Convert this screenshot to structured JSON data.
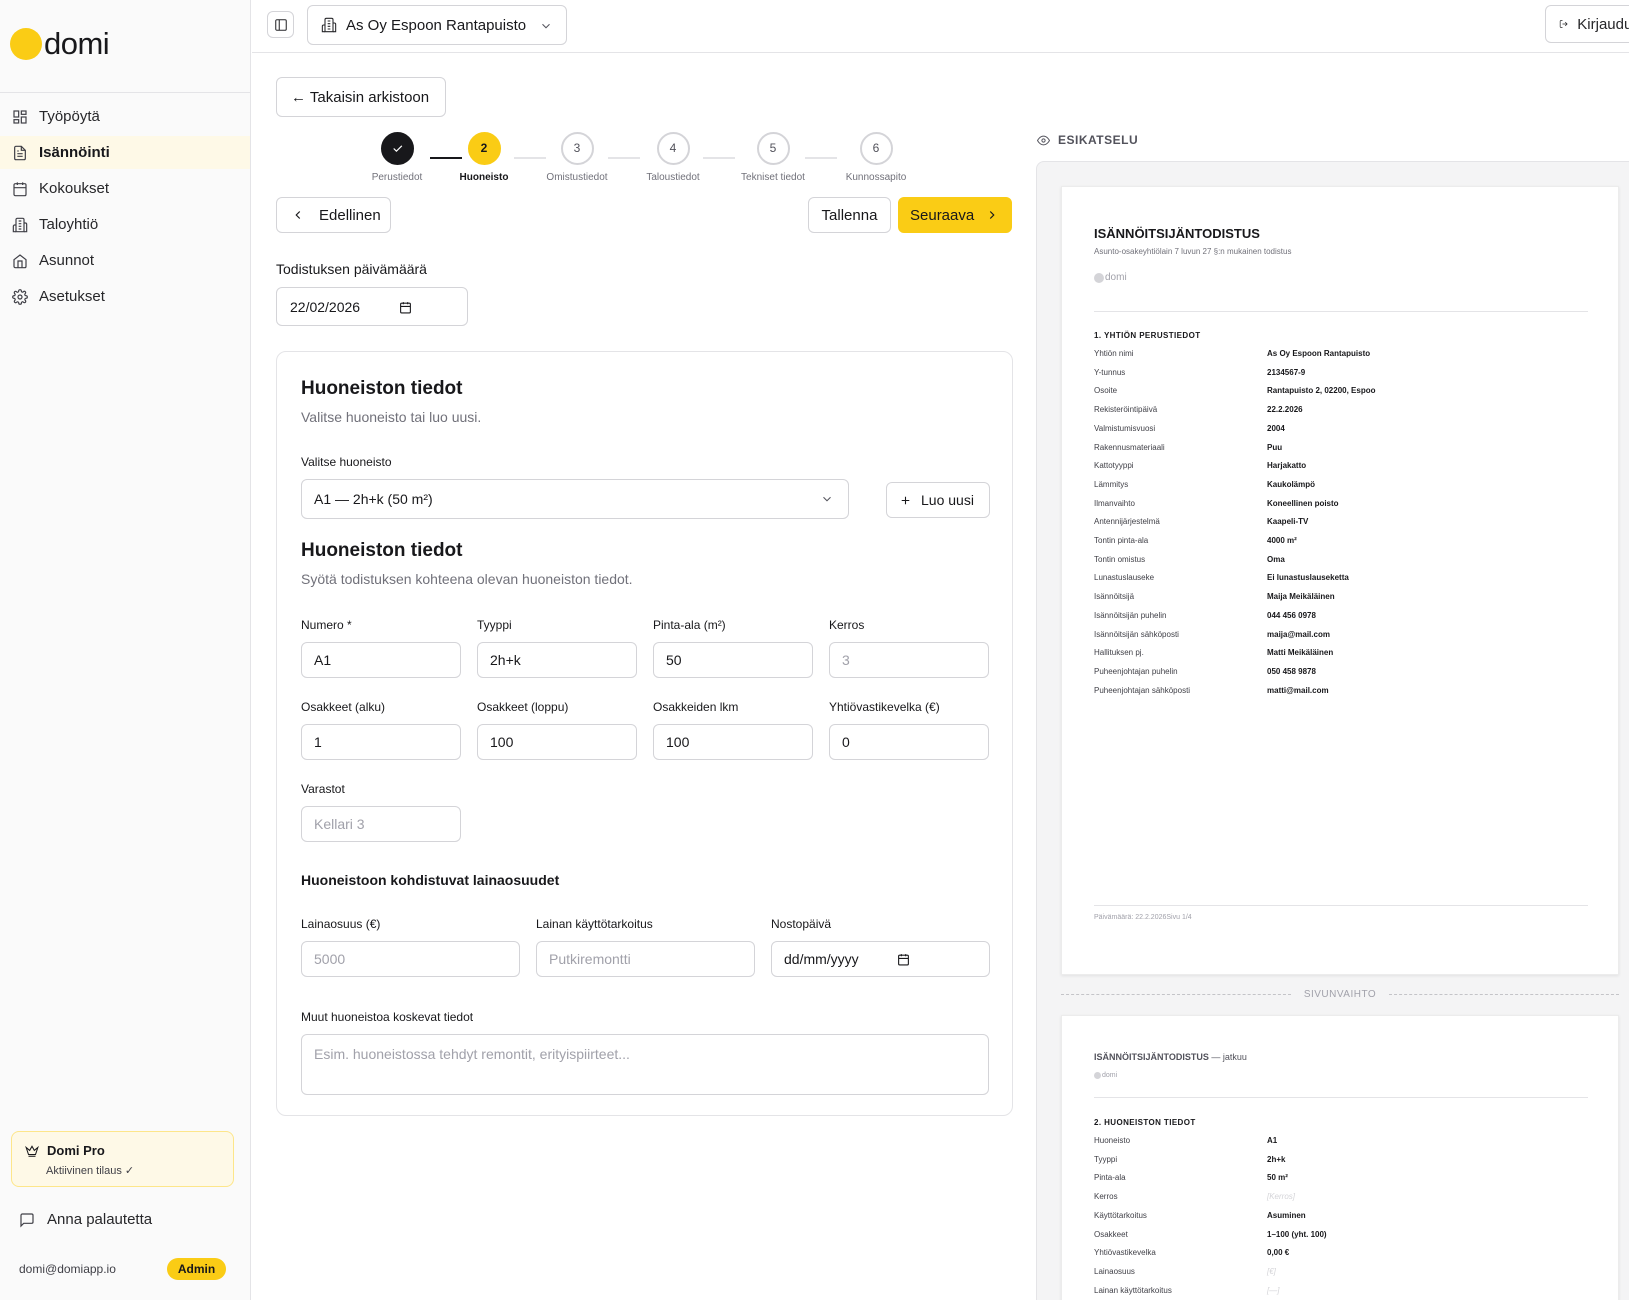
{
  "brand": {
    "name": "domi",
    "color": "#facc15"
  },
  "sidebar": {
    "items": [
      {
        "label": "Työpöytä",
        "icon": "dashboard-icon"
      },
      {
        "label": "Isännöinti",
        "icon": "document-icon",
        "active": true
      },
      {
        "label": "Kokoukset",
        "icon": "calendar-icon"
      },
      {
        "label": "Taloyhtiö",
        "icon": "building-icon"
      },
      {
        "label": "Asunnot",
        "icon": "home-icon"
      },
      {
        "label": "Asetukset",
        "icon": "gear-icon"
      }
    ],
    "plan": {
      "title": "Domi Pro",
      "status": "Aktiivinen tilaus ✓"
    },
    "feedback_label": "Anna palautetta",
    "user_email": "domi@domiapp.io",
    "role_badge": "Admin"
  },
  "topbar": {
    "company": "As Oy Espoon Rantapuisto",
    "logout_label": "Kirjaudu ulos"
  },
  "nav": {
    "back_label": "← Takaisin arkistoon",
    "prev_label": "Edellinen",
    "save_label": "Tallenna",
    "next_label": "Seuraava"
  },
  "stepper": {
    "steps": [
      {
        "number": "1",
        "label": "Perustiedot",
        "state": "done"
      },
      {
        "number": "2",
        "label": "Huoneisto",
        "state": "current"
      },
      {
        "number": "3",
        "label": "Omistustiedot",
        "state": "pending"
      },
      {
        "number": "4",
        "label": "Taloustiedot",
        "state": "pending"
      },
      {
        "number": "5",
        "label": "Tekniset tiedot",
        "state": "pending"
      },
      {
        "number": "6",
        "label": "Kunnossapito",
        "state": "pending"
      }
    ]
  },
  "certificate_date": {
    "label": "Todistuksen päivämäärä",
    "value": "22/02/2026"
  },
  "form": {
    "select_section": {
      "title": "Huoneiston tiedot",
      "subtitle": "Valitse huoneisto tai luo uusi.",
      "select_label": "Valitse huoneisto",
      "selected": "A1 — 2h+k (50 m²)",
      "create_label": "Luo uusi"
    },
    "details_section": {
      "title": "Huoneiston tiedot",
      "subtitle": "Syötä todistuksen kohteena olevan huoneiston tiedot."
    },
    "fields": {
      "numero": {
        "label": "Numero *",
        "value": "A1"
      },
      "tyyppi": {
        "label": "Tyyppi",
        "value": "2h+k"
      },
      "pinta_ala": {
        "label": "Pinta-ala (m²)",
        "value": "50"
      },
      "kerros": {
        "label": "Kerros",
        "placeholder": "3"
      },
      "osakkeet_alku": {
        "label": "Osakkeet (alku)",
        "value": "1"
      },
      "osakkeet_loppu": {
        "label": "Osakkeet (loppu)",
        "value": "100"
      },
      "osakkeiden_lkm": {
        "label": "Osakkeiden lkm",
        "value": "100"
      },
      "yhtiovastikevelka": {
        "label": "Yhtiövastikevelka (€)",
        "value": "0"
      },
      "varastot": {
        "label": "Varastot",
        "placeholder": "Kellari 3"
      }
    },
    "loans": {
      "title": "Huoneistoon kohdistuvat lainaosuudet",
      "lainaosuus": {
        "label": "Lainaosuus (€)",
        "placeholder": "5000"
      },
      "kayttotarkoitus": {
        "label": "Lainan käyttötarkoitus",
        "placeholder": "Putkiremontti"
      },
      "nostopaiva": {
        "label": "Nostopäivä",
        "placeholder": "dd/mm/yyyy"
      }
    },
    "other": {
      "label": "Muut huoneistoa koskevat tiedot",
      "placeholder": "Esim. huoneistossa tehdyt remontit, erityispiirteet..."
    }
  },
  "preview": {
    "title": "ESIKATSELU",
    "doc_title": "ISÄNNÖITSIJÄNTODISTUS",
    "doc_subtitle": "Asunto-osakeyhtiölain 7 luvun 27 §:n mukainen todistus",
    "logo_text": "domi",
    "section1_title": "1. YHTIÖN PERUSTIEDOT",
    "section1_rows": [
      {
        "k": "Yhtiön nimi",
        "v": "As Oy Espoon Rantapuisto"
      },
      {
        "k": "Y-tunnus",
        "v": "2134567-9"
      },
      {
        "k": "Osoite",
        "v": "Rantapuisto 2, 02200, Espoo"
      },
      {
        "k": "Rekisteröintipäivä",
        "v": "22.2.2026"
      },
      {
        "k": "Valmistumisvuosi",
        "v": "2004"
      },
      {
        "k": "Rakennusmateriaali",
        "v": "Puu"
      },
      {
        "k": "Kattotyyppi",
        "v": "Harjakatto"
      },
      {
        "k": "Lämmitys",
        "v": "Kaukolämpö"
      },
      {
        "k": "Ilmanvaihto",
        "v": "Koneellinen poisto"
      },
      {
        "k": "Antennijärjestelmä",
        "v": "Kaapeli-TV"
      },
      {
        "k": "Tontin pinta-ala",
        "v": "4000 m²"
      },
      {
        "k": "Tontin omistus",
        "v": "Oma"
      },
      {
        "k": "Lunastuslauseke",
        "v": "Ei lunastuslauseketta"
      },
      {
        "k": "Isännöitsijä",
        "v": "Maija Meikäläinen"
      },
      {
        "k": "Isännöitsijän puhelin",
        "v": "044 456 0978"
      },
      {
        "k": "Isännöitsijän sähköposti",
        "v": "maija@mail.com"
      },
      {
        "k": "Hallituksen pj.",
        "v": "Matti Meikäläinen"
      },
      {
        "k": "Puheenjohtajan puhelin",
        "v": "050 458 9878"
      },
      {
        "k": "Puheenjohtajan sähköposti",
        "v": "matti@mail.com"
      }
    ],
    "footer": "Päivämäärä: 22.2.2026Sivu 1/4",
    "page_break": "SIVUNVAIHTO",
    "doc2_title": "ISÄNNÖITSIJÄNTODISTUS",
    "doc2_suffix": " — jatkuu",
    "section2_title": "2. HUONEISTON TIEDOT",
    "section2_rows": [
      {
        "k": "Huoneisto",
        "v": "A1"
      },
      {
        "k": "Tyyppi",
        "v": "2h+k"
      },
      {
        "k": "Pinta-ala",
        "v": "50 m²"
      },
      {
        "k": "Kerros",
        "v": "[Kerros]",
        "empty": true
      },
      {
        "k": "Käyttötarkoitus",
        "v": "Asuminen"
      },
      {
        "k": "Osakkeet",
        "v": "1–100 (yht. 100)"
      },
      {
        "k": "Yhtiövastikevelka",
        "v": "0,00 €"
      },
      {
        "k": "Lainaosuus",
        "v": "[€]",
        "empty": true
      },
      {
        "k": "Lainan käyttötarkoitus",
        "v": "[—]",
        "empty": true
      }
    ]
  }
}
